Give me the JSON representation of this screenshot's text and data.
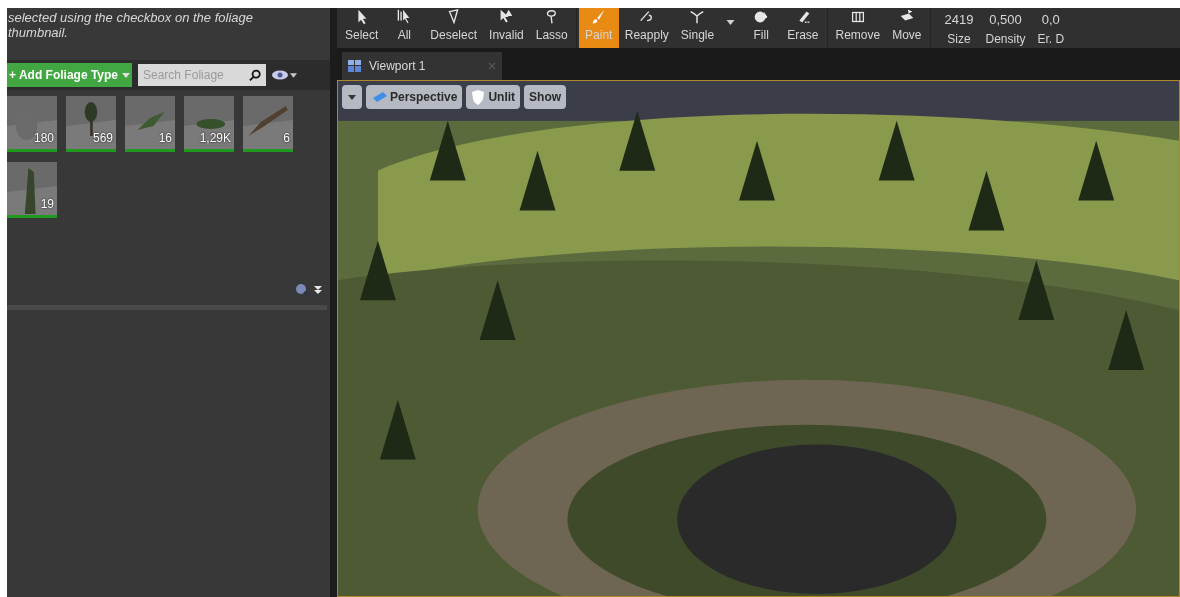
{
  "foliage_panel": {
    "hint": "selected using the checkbox on the foliage thumbnail.",
    "add_button": "+ Add Foliage Type",
    "search": {
      "placeholder": "Search Foliage"
    },
    "thumbnails": [
      {
        "count": "180",
        "active": true
      },
      {
        "count": "569",
        "active": true
      },
      {
        "count": "16",
        "active": true
      },
      {
        "count": "1,29K",
        "active": true
      },
      {
        "count": "6",
        "active": true
      },
      {
        "count": "19",
        "active": true
      }
    ]
  },
  "toolbar": {
    "groups": [
      [
        {
          "label": "Select",
          "selected": false
        },
        {
          "label": "All",
          "selected": false
        },
        {
          "label": "Deselect",
          "selected": false
        },
        {
          "label": "Invalid",
          "selected": false
        },
        {
          "label": "Lasso",
          "selected": false
        }
      ],
      [
        {
          "label": "Paint",
          "selected": true
        },
        {
          "label": "Reapply",
          "selected": false
        },
        {
          "label": "Single",
          "selected": false
        },
        {
          "label": "Fill",
          "selected": false
        },
        {
          "label": "Erase",
          "selected": false
        }
      ],
      [
        {
          "label": "Remove",
          "selected": false
        },
        {
          "label": "Move",
          "selected": false
        }
      ]
    ],
    "settings": [
      {
        "value": "2419",
        "label": "Size"
      },
      {
        "value": "0,500",
        "label": "Density"
      },
      {
        "value": "0,0",
        "label": "Er. D"
      }
    ]
  },
  "viewport": {
    "tab": "Viewport 1",
    "buttons": [
      "Perspective",
      "Unlit",
      "Show"
    ]
  }
}
